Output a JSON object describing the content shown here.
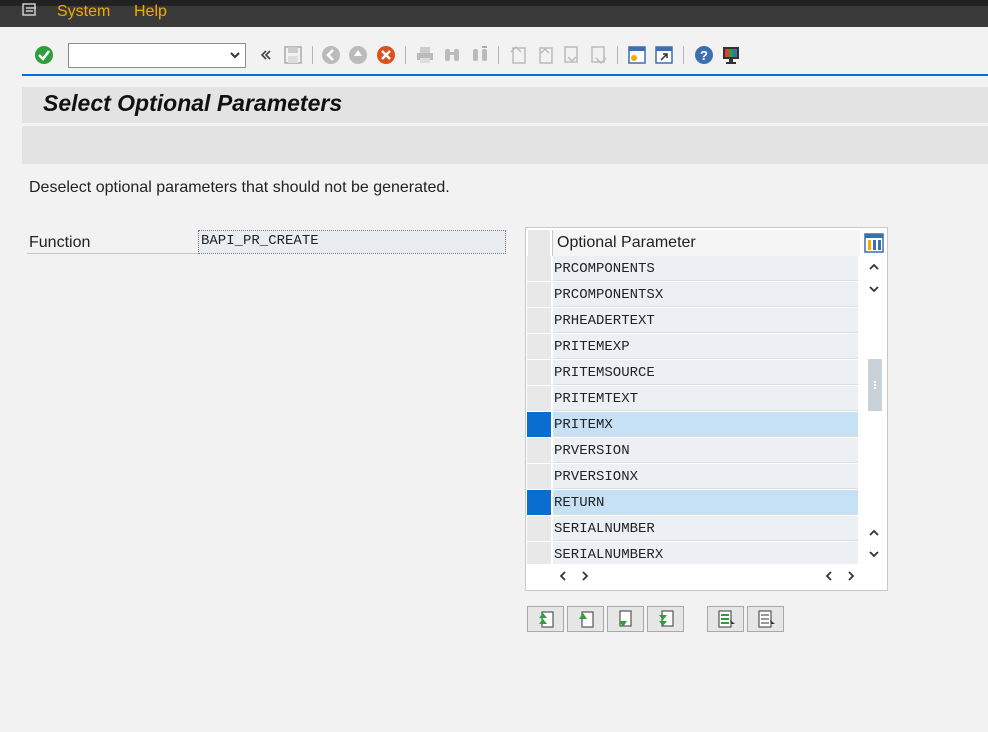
{
  "menu": {
    "items": [
      {
        "label": "System"
      },
      {
        "label": "Help"
      }
    ]
  },
  "toolbar": {
    "command_value": "",
    "command_placeholder": ""
  },
  "screen": {
    "title": "Select Optional Parameters",
    "instruction": "Deselect optional parameters that should not be generated."
  },
  "function_field": {
    "label": "Function",
    "value": "BAPI_PR_CREATE"
  },
  "table": {
    "column_header": "Optional Parameter",
    "rows": [
      {
        "value": "PRCOMPONENTS",
        "selected": false
      },
      {
        "value": "PRCOMPONENTSX",
        "selected": false
      },
      {
        "value": "PRHEADERTEXT",
        "selected": false
      },
      {
        "value": "PRITEMEXP",
        "selected": false
      },
      {
        "value": "PRITEMSOURCE",
        "selected": false
      },
      {
        "value": "PRITEMTEXT",
        "selected": false
      },
      {
        "value": "PRITEMX",
        "selected": true
      },
      {
        "value": "PRVERSION",
        "selected": false
      },
      {
        "value": "PRVERSIONX",
        "selected": false
      },
      {
        "value": "RETURN",
        "selected": true
      },
      {
        "value": "SERIALNUMBER",
        "selected": false
      },
      {
        "value": "SERIALNUMBERX",
        "selected": false
      }
    ]
  },
  "colors": {
    "accent": "#0a6ed1",
    "menu_text": "#f0ab00",
    "selected_row": "#c6e1f6"
  }
}
